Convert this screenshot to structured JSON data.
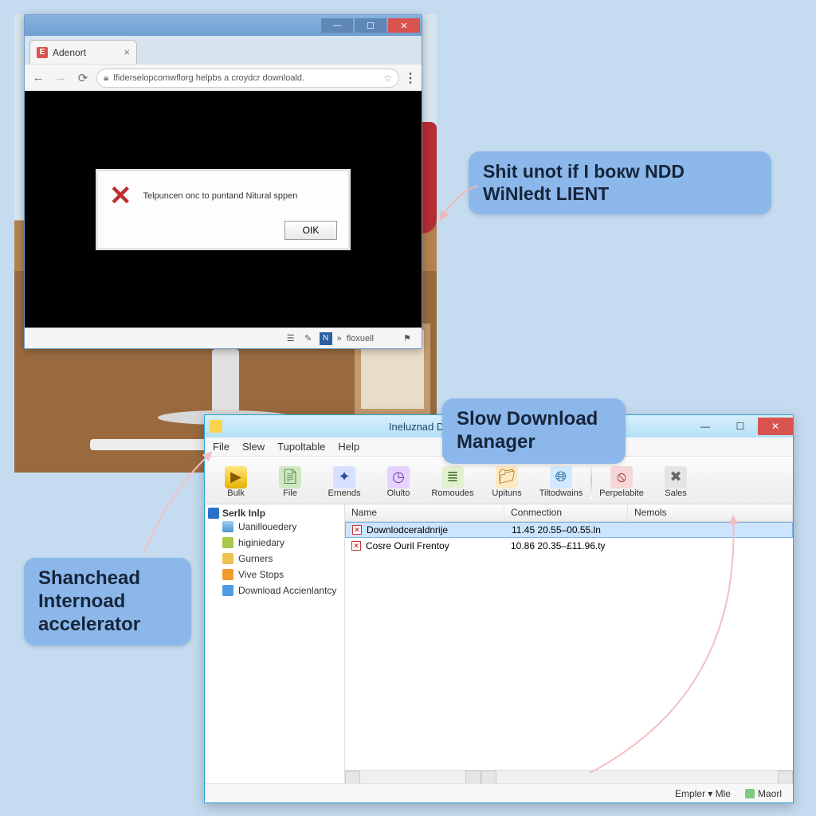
{
  "callouts": {
    "c1": "Shit unot if I boкw NDD  WiNledt LIENT",
    "c2": "Slow Download Manager",
    "c3": "Shanchead Internoad accelerator"
  },
  "browser": {
    "tab_title": "Adenort",
    "url": "lfiderselopcomwflorg helpbs a croydcr downloald.",
    "status_label": "floxuell",
    "dialog": {
      "text": "Telpuncen onc to puntand Nitural sppen",
      "ok": "OIK"
    }
  },
  "dm": {
    "title": "Ineluznad Download Connec",
    "menu": [
      "File",
      "Slew",
      "Tupoltable",
      "Help"
    ],
    "toolbar": [
      {
        "label": "Bulk"
      },
      {
        "label": "File"
      },
      {
        "label": "Ernends"
      },
      {
        "label": "Olulto"
      },
      {
        "label": "Romoudes"
      },
      {
        "label": "Upituns"
      },
      {
        "label": "Tiltodwains"
      },
      {
        "label": "Perpelabite"
      },
      {
        "label": "Sales"
      }
    ],
    "tree": {
      "root": "Serlk Inlp",
      "items": [
        "Uanillouedery",
        "higiniedary",
        "Gurners",
        "Vive Stops",
        "Download Accienlantcy"
      ]
    },
    "list": {
      "headers": [
        "Name",
        "Conmection",
        "Nemols"
      ],
      "rows": [
        {
          "name": "Downlodceraldnrije",
          "conn": "11.45 20.55–00.55.ln",
          "sel": true
        },
        {
          "name": "Cosre Ouril Frentoy",
          "conn": "10.86 20.35–£11.96.ty",
          "sel": false
        }
      ]
    },
    "status": {
      "a": "Empler ▾ Mle",
      "b": "Maorl"
    }
  }
}
